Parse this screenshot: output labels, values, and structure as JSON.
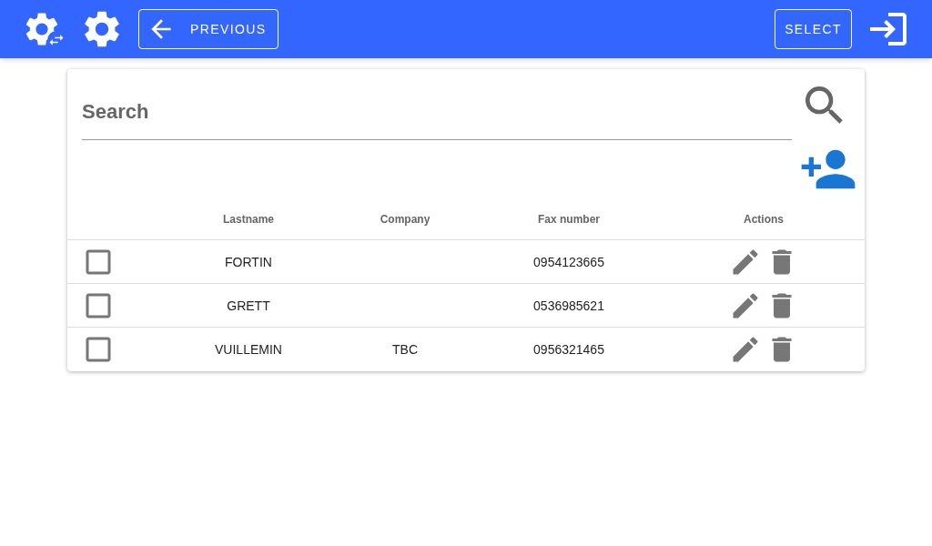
{
  "toolbar": {
    "previous_label": "PREVIOUS",
    "select_label": "SELECT"
  },
  "search": {
    "placeholder": "Search"
  },
  "table": {
    "columns": [
      "Lastname",
      "Company",
      "Fax number",
      "Actions"
    ],
    "rows": [
      {
        "checked": false,
        "lastname": "FORTIN",
        "company": "",
        "fax": "0954123665"
      },
      {
        "checked": false,
        "lastname": "GRETT",
        "company": "",
        "fax": "0536985621"
      },
      {
        "checked": false,
        "lastname": "VUILLEMIN",
        "company": "TBC",
        "fax": "0956321465"
      }
    ]
  }
}
